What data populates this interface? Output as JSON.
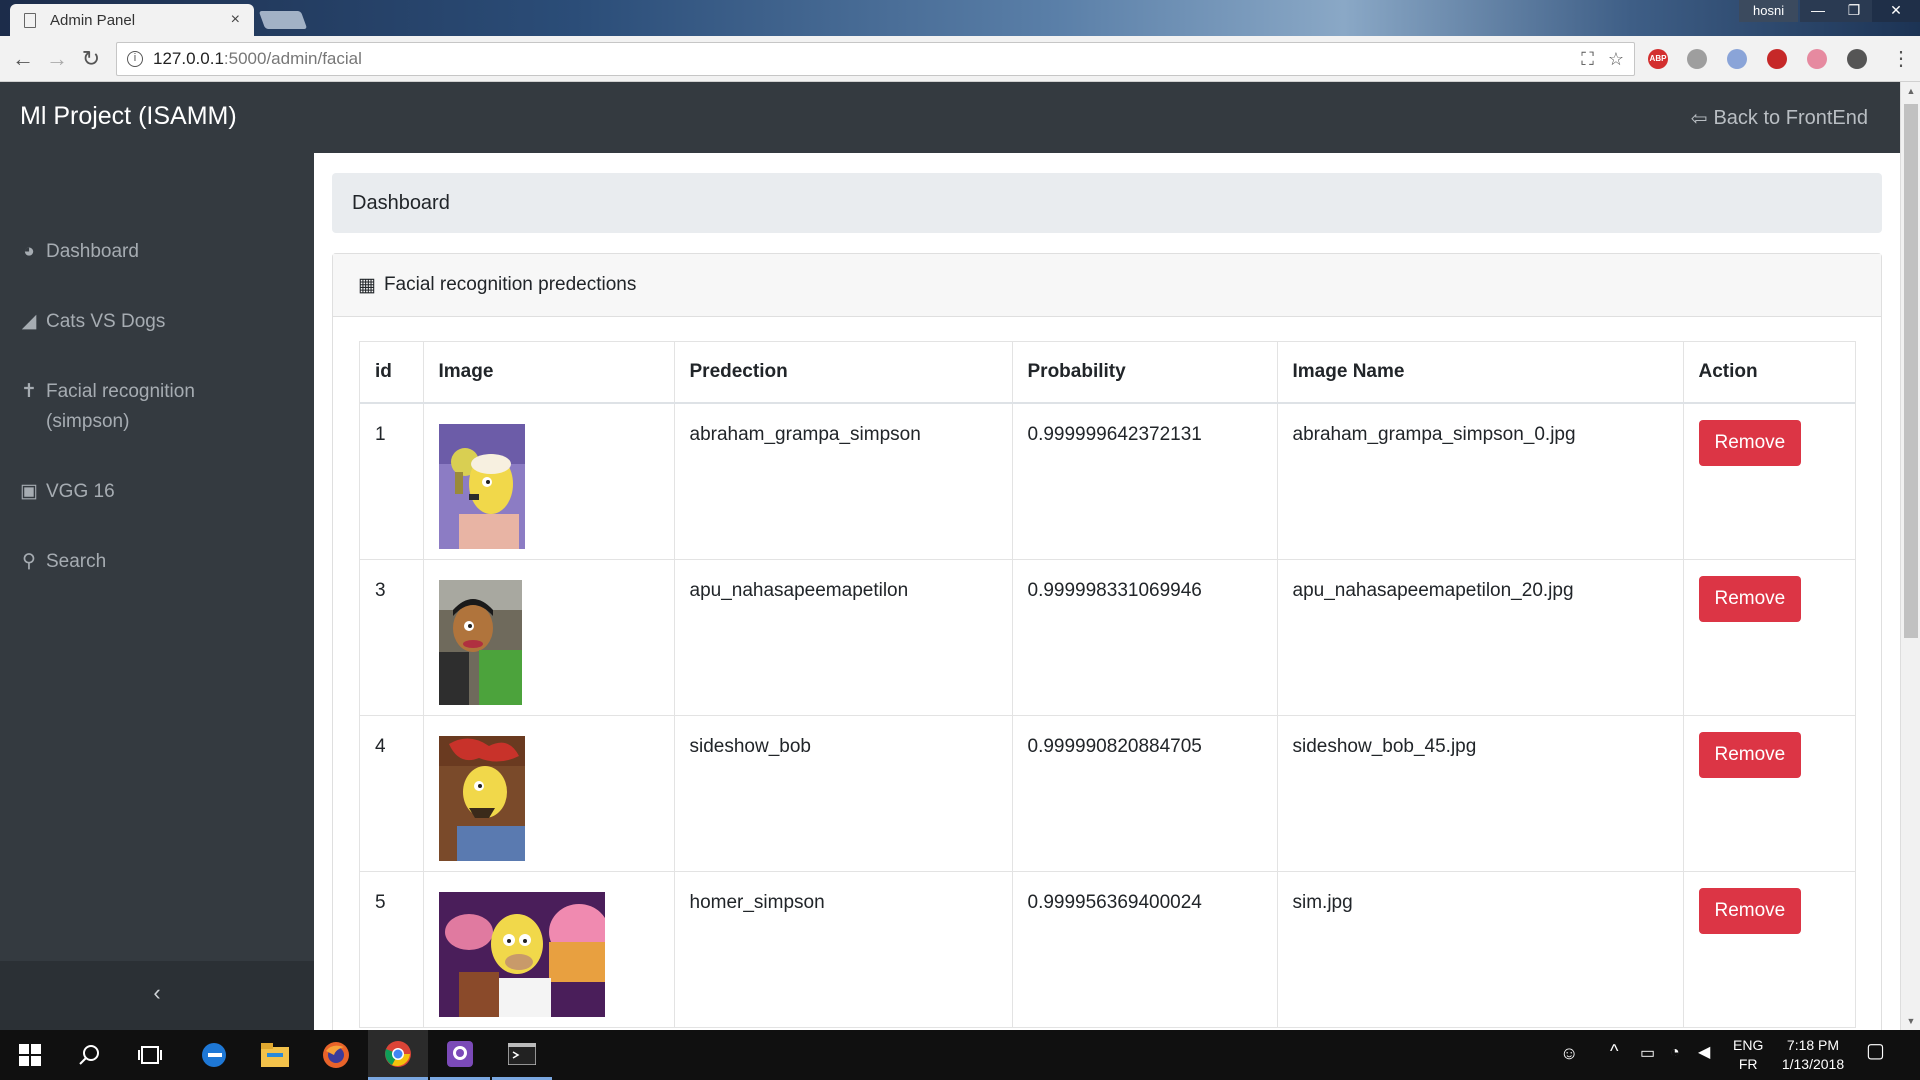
{
  "browser": {
    "tab_title": "Admin Panel",
    "tab_close": "×",
    "user": "hosni",
    "url_host": "127.0.0.1",
    "url_path": ":5000/admin/facial",
    "extensions": [
      "ABP"
    ]
  },
  "header": {
    "brand": "Ml Project (ISAMM)",
    "back_link": "Back to FrontEnd"
  },
  "sidebar": {
    "items": [
      {
        "label": "Dashboard",
        "icon": "tachometer-icon"
      },
      {
        "label": "Cats VS Dogs",
        "icon": "area-chart-icon"
      },
      {
        "label": "Facial recognition (simpson)",
        "icon": "child-icon"
      },
      {
        "label": "VGG 16",
        "icon": "image-icon"
      },
      {
        "label": "Search",
        "icon": "search-icon"
      }
    ],
    "toggle": "‹"
  },
  "breadcrumb": "Dashboard",
  "card": {
    "title": "Facial recognition predections"
  },
  "table": {
    "columns": [
      "id",
      "Image",
      "Predection",
      "Probability",
      "Image Name",
      "Action"
    ],
    "rows": [
      {
        "id": "1",
        "prediction": "abraham_grampa_simpson",
        "probability": "0.999999642372131",
        "image_name": "abraham_grampa_simpson_0.jpg",
        "action": "Remove"
      },
      {
        "id": "3",
        "prediction": "apu_nahasapeemapetilon",
        "probability": "0.999998331069946",
        "image_name": "apu_nahasapeemapetilon_20.jpg",
        "action": "Remove"
      },
      {
        "id": "4",
        "prediction": "sideshow_bob",
        "probability": "0.999990820884705",
        "image_name": "sideshow_bob_45.jpg",
        "action": "Remove"
      },
      {
        "id": "5",
        "prediction": "homer_simpson",
        "probability": "0.999956369400024",
        "image_name": "sim.jpg",
        "action": "Remove"
      }
    ]
  },
  "taskbar": {
    "lang_top": "ENG",
    "lang_bottom": "FR",
    "time": "7:18 PM",
    "date": "1/13/2018"
  },
  "colors": {
    "danger": "#dc3545",
    "sidebar_bg": "#343a40",
    "breadcrumb_bg": "#e9ecef"
  }
}
